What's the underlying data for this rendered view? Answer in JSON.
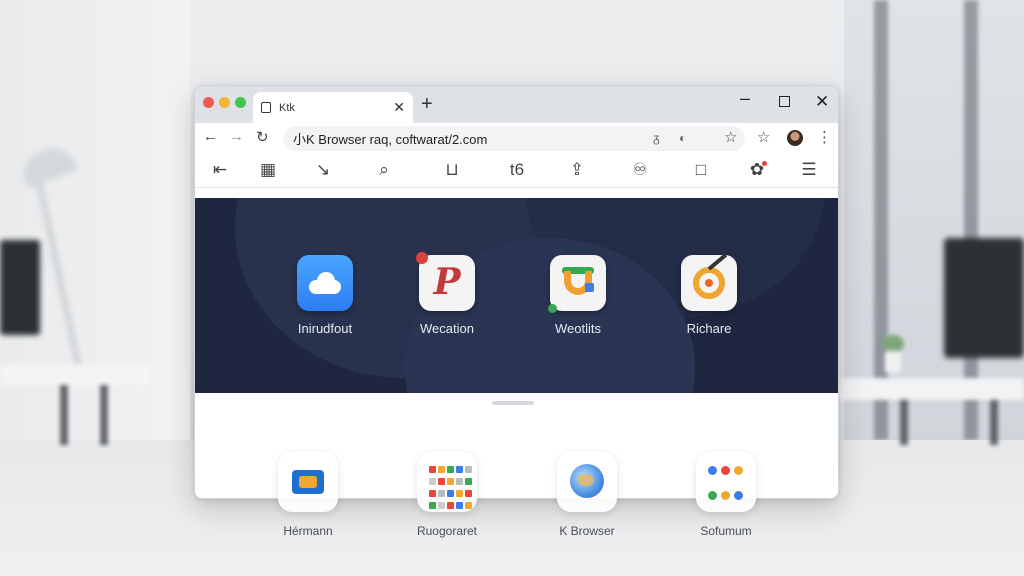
{
  "tab": {
    "title": "Ktk"
  },
  "address": {
    "url": "小K Browser raq, coftwarat/2.com"
  },
  "apps": [
    {
      "label": "Inirudfout"
    },
    {
      "label": "Wecation"
    },
    {
      "label": "Weotlits"
    },
    {
      "label": "Richare"
    }
  ],
  "dock": [
    {
      "label": "Hérmann"
    },
    {
      "label": "Ruogoraret"
    },
    {
      "label": "K Browser"
    },
    {
      "label": "Sofumum"
    }
  ],
  "colors": {
    "hero_bg": "#1f2740",
    "titlebar_bg": "#dee1e6",
    "accent_red": "#f05a52",
    "accent_yellow": "#f3b634",
    "accent_green": "#3ec54d"
  },
  "icons": {
    "toolbar": [
      "back-arrow-icon",
      "grid-icon",
      "pen-icon",
      "search-icon",
      "bookmark-u-icon",
      "text-icon",
      "share-icon",
      "sync-icon",
      "book-icon",
      "extension-icon",
      "menu-icon"
    ],
    "address": [
      "back-icon",
      "forward-icon",
      "reload-icon",
      "translate-icon",
      "star-icon",
      "bookmark-star-icon",
      "kebab-menu-icon"
    ]
  }
}
